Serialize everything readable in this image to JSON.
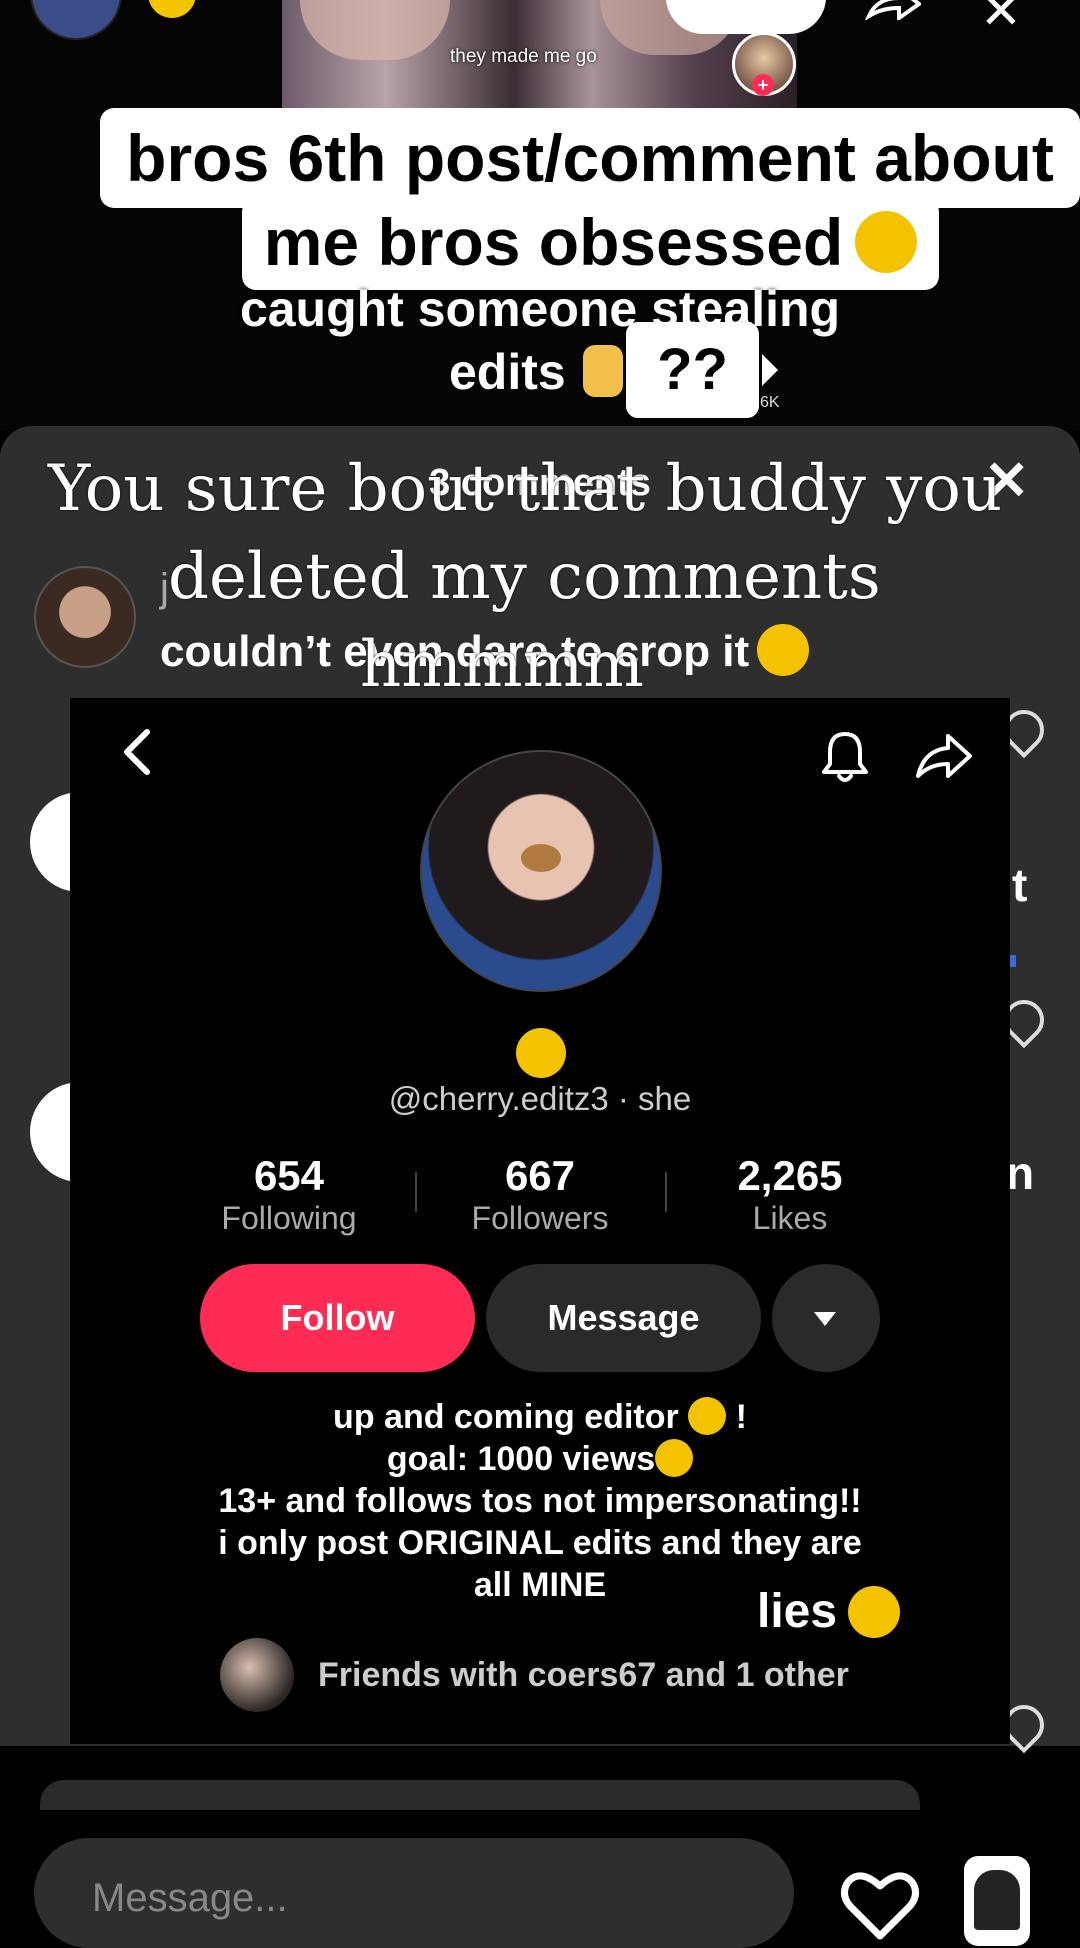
{
  "video": {
    "thumb_caption": "they made me go",
    "caption_line_1": "bros 6th post/comment about",
    "caption_line_2": "me bros obsessed",
    "description_line_1": "caught someone stealing",
    "description_line_2": "edits",
    "question_marks": "??",
    "play_count": "6K"
  },
  "comments": {
    "title": "3 comments",
    "first_comment": {
      "username": "j",
      "text": "couldn’t even dare to crop it"
    }
  },
  "profile": {
    "handle": "@cherry.editz3 · she",
    "stats": [
      {
        "value": "654",
        "label": "Following"
      },
      {
        "value": "667",
        "label": "Followers"
      },
      {
        "value": "2,265",
        "label": "Likes"
      }
    ],
    "follow_label": "Follow",
    "message_label": "Message",
    "bio": {
      "line_1": "up and coming editor",
      "line_1_tail": " !",
      "line_2": "goal: 1000 views",
      "line_3": "13+ and follows tos not impersonating!!",
      "line_4": "i only post ORIGINAL edits and they are",
      "line_5": "all MINE"
    },
    "friends_text": "Friends with coers67 and 1 other"
  },
  "overlay": {
    "line_1": "You sure bout that buddy you",
    "line_2": "deleted my comments",
    "line_3": "hmmmm",
    "lies": "lies"
  },
  "side_fragments": {
    "letter_1": "t",
    "letter_2": "n"
  },
  "composer": {
    "placeholder": "Message..."
  },
  "colors": {
    "accent": "#fe2c55",
    "sheet": "#2e2e2e",
    "background": "#000000"
  }
}
